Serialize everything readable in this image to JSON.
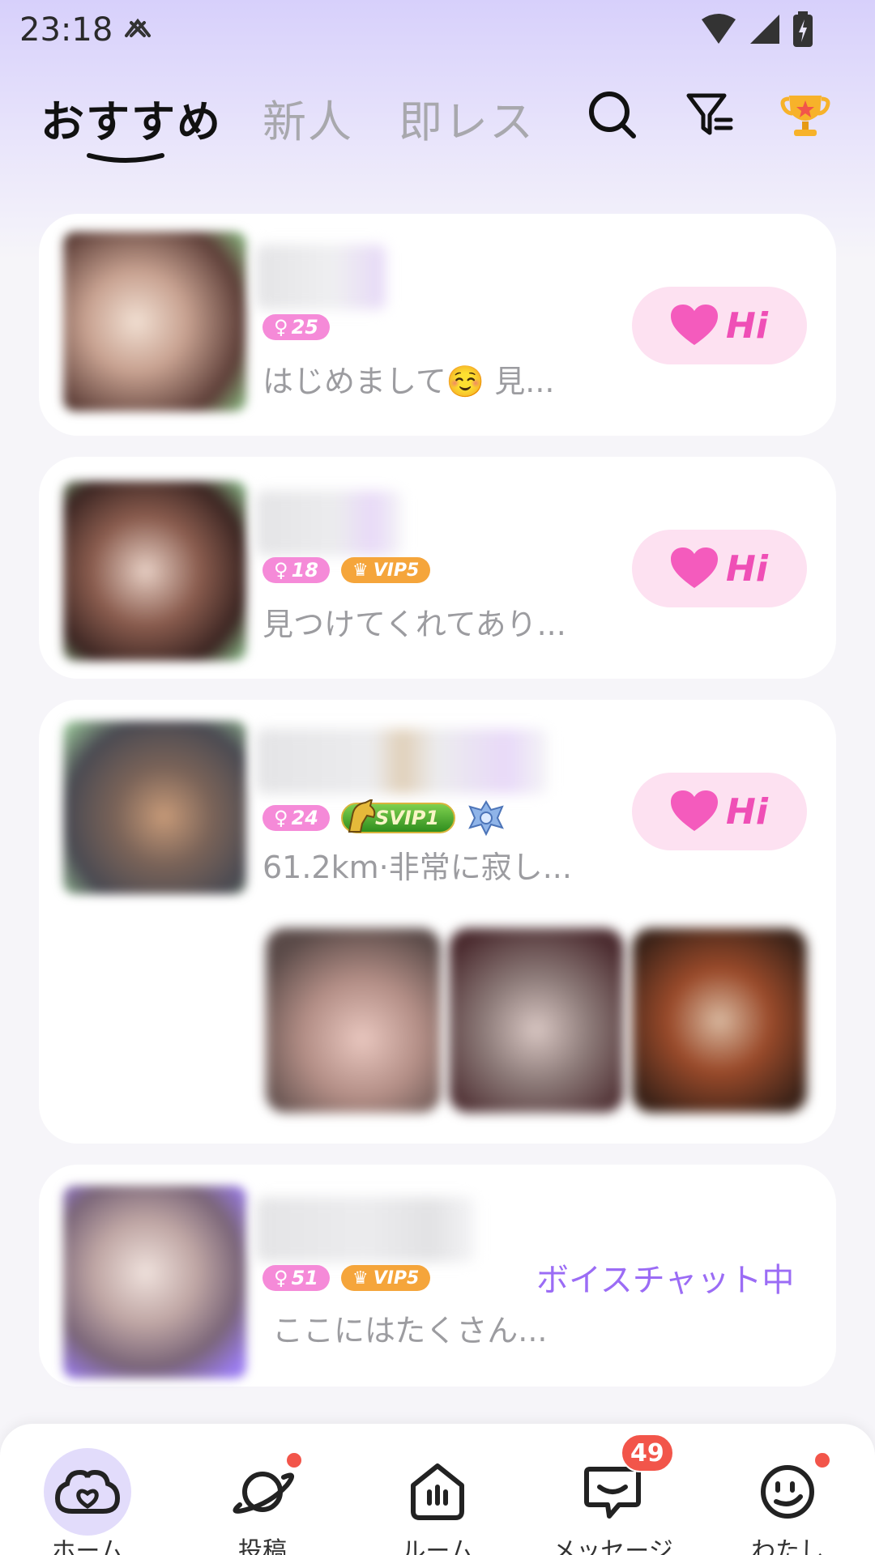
{
  "status_bar": {
    "time": "23:18"
  },
  "header": {
    "tabs": [
      {
        "label": "おすすめ"
      },
      {
        "label": "新人"
      },
      {
        "label": "即レス"
      }
    ]
  },
  "feed": [
    {
      "age": "25",
      "message": "はじめまして☺️ 見...",
      "hi_label": "Hi"
    },
    {
      "age": "18",
      "vip": "VIP5",
      "message": "見つけてくれてあり...",
      "hi_label": "Hi"
    },
    {
      "age": "24",
      "svip": "SVIP1",
      "message": "61.2km·非常に寂し...",
      "hi_label": "Hi"
    },
    {
      "age": "51",
      "vip": "VIP5",
      "message": "ここにはたくさん...",
      "status": "ボイスチャット中"
    }
  ],
  "bottom_nav": [
    {
      "label": "ホーム"
    },
    {
      "label": "投稿"
    },
    {
      "label": "ルーム"
    },
    {
      "label": "メッセージ",
      "badge": "49"
    },
    {
      "label": "わたし"
    }
  ],
  "colors": {
    "accent_purple": "#9b6cf5",
    "hi_pink": "#ef4fb6",
    "age_badge": "#f58ad8",
    "vip_badge": "#f5a53b",
    "notification_red": "#f2554a"
  },
  "icons": [
    "wifi-icon",
    "signal-icon",
    "battery-icon",
    "search-icon",
    "filter-icon",
    "trophy-icon",
    "heart-icon",
    "home-icon",
    "planet-icon",
    "room-icon",
    "message-icon",
    "face-icon"
  ]
}
